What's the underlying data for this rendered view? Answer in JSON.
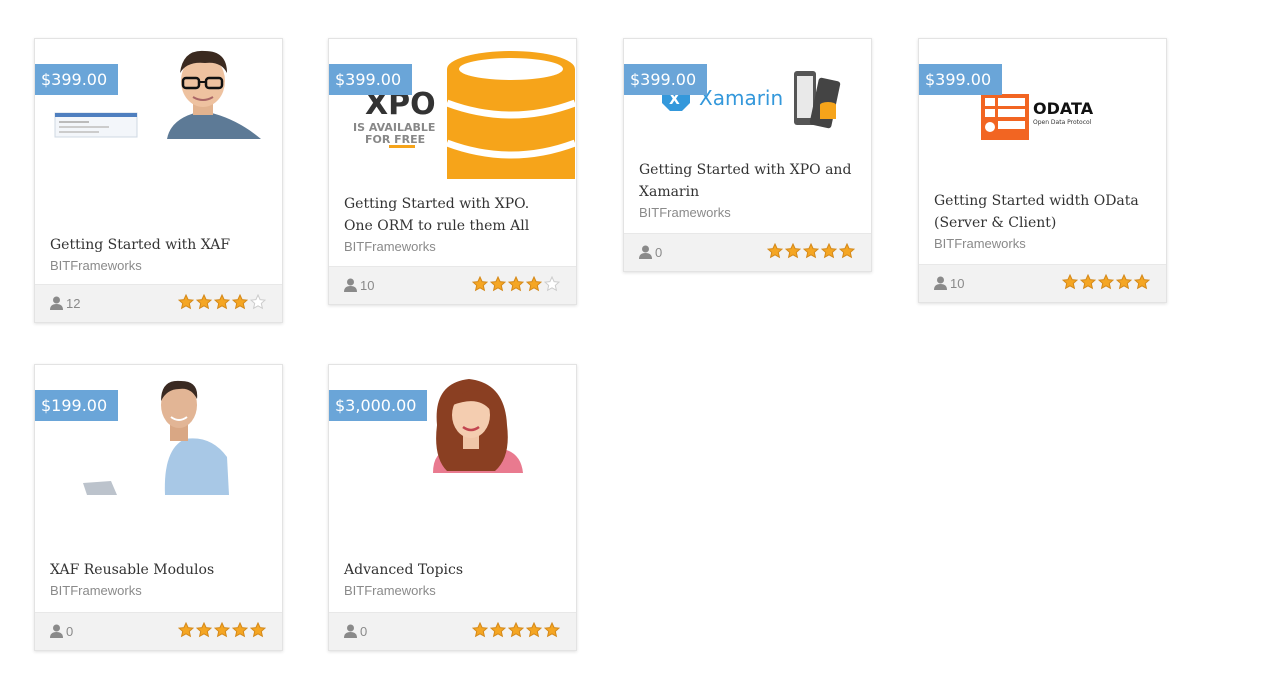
{
  "courses": [
    {
      "price": "$399.00",
      "title": "Getting Started with XAF",
      "author": "BITFrameworks",
      "students": "12",
      "rating": 4
    },
    {
      "price": "$399.00",
      "title": "Getting Started with XPO. One ORM to rule them All",
      "author": "BITFrameworks",
      "students": "10",
      "rating": 4,
      "image_text": {
        "brand": "XPO",
        "line1": "IS AVAILABLE",
        "line2": "FOR FREE"
      }
    },
    {
      "price": "$399.00",
      "title": "Getting Started with XPO and Xamarin",
      "author": "BITFrameworks",
      "students": "0",
      "rating": 5,
      "image_text": {
        "brand": "Xamarin"
      }
    },
    {
      "price": "$399.00",
      "title": "Getting Started width OData (Server & Client)",
      "author": "BITFrameworks",
      "students": "10",
      "rating": 5,
      "image_text": {
        "brand": "ODATA",
        "sub": "Open Data Protocol"
      }
    },
    {
      "price": "$199.00",
      "title": "XAF Reusable Modulos",
      "author": "BITFrameworks",
      "students": "0",
      "rating": 5
    },
    {
      "price": "$3,000.00",
      "title": "Advanced Topics",
      "author": "BITFrameworks",
      "students": "0",
      "rating": 5
    }
  ],
  "colors": {
    "price_tag": "#6aa5d8",
    "star": "#f5a623",
    "star_empty": "#cccccc",
    "footer": "#f2f2f2"
  }
}
